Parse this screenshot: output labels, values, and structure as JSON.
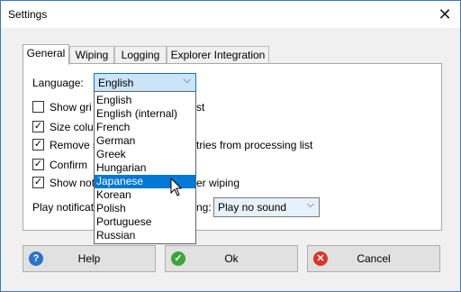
{
  "window": {
    "title": "Settings"
  },
  "tabs": [
    "General",
    "Wiping",
    "Logging",
    "Explorer Integration"
  ],
  "language": {
    "label": "Language:",
    "value": "English"
  },
  "options": [
    {
      "label": "Show gri",
      "suffix": "st",
      "checked": false
    },
    {
      "label": "Size colu",
      "suffix": "",
      "checked": true
    },
    {
      "label": "Remove s",
      "suffix": "tries from processing list",
      "checked": true
    },
    {
      "label": "Confirm",
      "suffix": "",
      "checked": true
    },
    {
      "label": "Show not",
      "suffix": "er wiping",
      "checked": true
    }
  ],
  "play": {
    "label": "Play notificat",
    "label_suffix": "ng:",
    "value": "Play no sound"
  },
  "dropdown_items": [
    "English",
    "English (internal)",
    "French",
    "German",
    "Greek",
    "Hungarian",
    "Japanese",
    "Korean",
    "Polish",
    "Portuguese",
    "Russian"
  ],
  "selected_dropdown_item": "Japanese",
  "buttons": {
    "help": "Help",
    "ok": "Ok",
    "cancel": "Cancel"
  },
  "colors": {
    "accent": "#0078d7",
    "help_icon": "#2a73c8",
    "ok_icon": "#3aa63a",
    "cancel_icon": "#d9352b"
  },
  "icons": {
    "help": "help-icon",
    "ok": "ok-icon",
    "cancel": "cancel-icon"
  }
}
